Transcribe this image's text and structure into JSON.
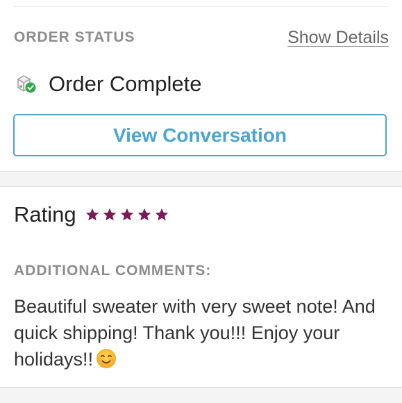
{
  "order_status": {
    "section_label": "ORDER STATUS",
    "show_details_label": "Show Details",
    "status_text": "Order Complete",
    "status_icon": "package-check-icon",
    "view_conversation_label": "View Conversation"
  },
  "rating": {
    "label": "Rating",
    "stars": 5,
    "max_stars": 5,
    "star_color": "#7a1a58"
  },
  "comments": {
    "section_label": "ADDITIONAL COMMENTS:",
    "text": "Beautiful sweater with very sweet note! And quick shipping! Thank you!!! Enjoy your holidays!!",
    "emoji": "smiling-face-emoji"
  },
  "colors": {
    "accent": "#4ba5cf",
    "success": "#2ea84a",
    "muted": "#8d8d8d"
  }
}
